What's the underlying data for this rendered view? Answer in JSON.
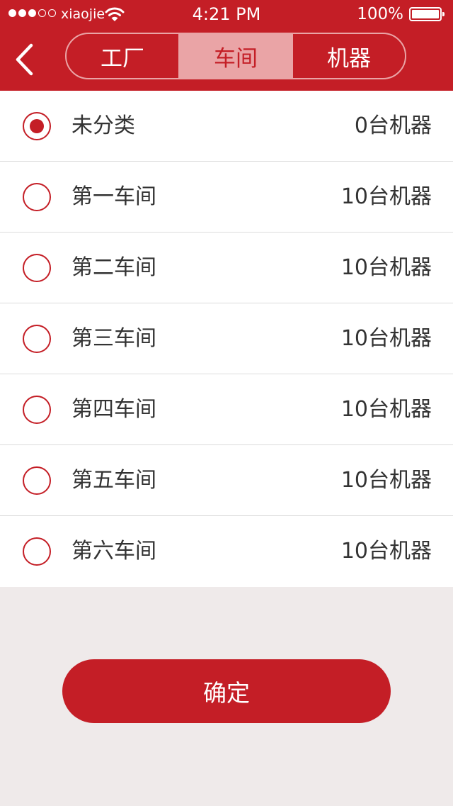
{
  "status_bar": {
    "carrier": "xiaojie",
    "time": "4:21 PM",
    "battery": "100%",
    "signal_bars_filled": 3,
    "signal_bars_total": 5
  },
  "header": {
    "back_icon": "chevron-left-icon",
    "tabs": [
      {
        "label": "工厂",
        "active": false
      },
      {
        "label": "车间",
        "active": true
      },
      {
        "label": "机器",
        "active": false
      }
    ]
  },
  "list": [
    {
      "label": "未分类",
      "count": "0台机器",
      "selected": true
    },
    {
      "label": "第一车间",
      "count": "10台机器",
      "selected": false
    },
    {
      "label": "第二车间",
      "count": "10台机器",
      "selected": false
    },
    {
      "label": "第三车间",
      "count": "10台机器",
      "selected": false
    },
    {
      "label": "第四车间",
      "count": "10台机器",
      "selected": false
    },
    {
      "label": "第五车间",
      "count": "10台机器",
      "selected": false
    },
    {
      "label": "第六车间",
      "count": "10台机器",
      "selected": false
    }
  ],
  "confirm_label": "确定",
  "colors": {
    "brand": "#c41e26",
    "tab_active_bg": "#eaa4a6",
    "page_bg": "#efeaea"
  }
}
